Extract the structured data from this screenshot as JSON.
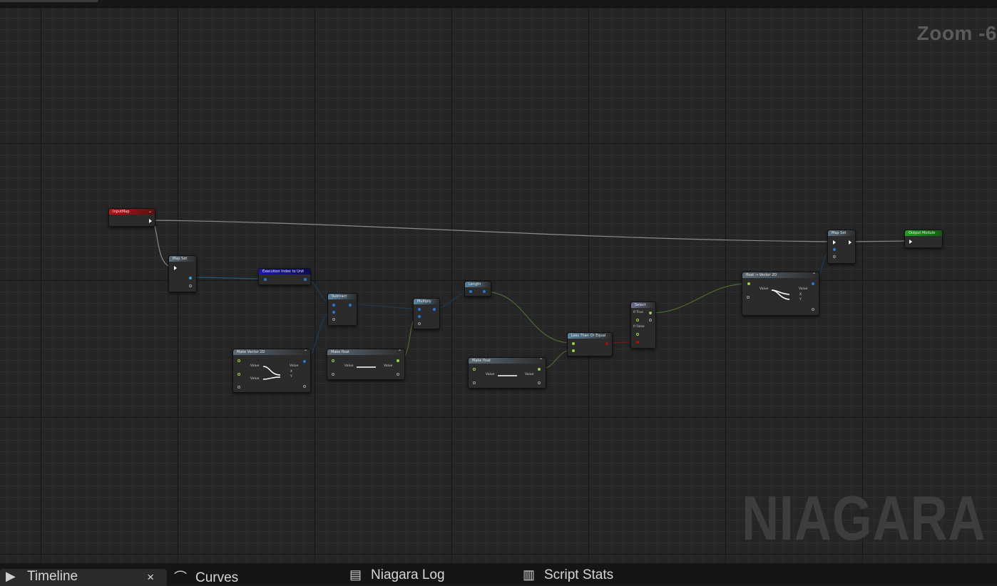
{
  "graph": {
    "zoom_label": "Zoom -6",
    "watermark": "NIAGARA",
    "nodes": {
      "input_map": {
        "title": "InputMap",
        "color": "#a11515"
      },
      "map_set_1": {
        "title": "Map Set",
        "color": "#4a5d6b"
      },
      "exec_index": {
        "title": "Execution Index to Unit",
        "color": "#15138a"
      },
      "subtract": {
        "title": "Subtract",
        "color": "#4e6b80"
      },
      "multiply": {
        "title": "Multiply",
        "color": "#4e6b80"
      },
      "length": {
        "title": "Length",
        "color": "#4e6b80"
      },
      "make_vector2d": {
        "title": "Make Vector 2D",
        "color": "#4e5c66",
        "pin_value_1": "Value",
        "pin_value_2": "Value",
        "out_value": "Value",
        "out_x": "X",
        "out_y": "Y"
      },
      "make_float_1": {
        "title": "Make float",
        "color": "#4e5c66",
        "pin_value": "Value",
        "out_value": "Value"
      },
      "make_float_2": {
        "title": "Make float",
        "color": "#4e5c66",
        "pin_value": "Value",
        "out_value": "Value"
      },
      "less_than": {
        "title": "Less Than Or Equal",
        "color": "#4e6b80"
      },
      "select": {
        "title": "Select",
        "color": "#5a6076",
        "if_true": "If True",
        "if_false": "If False"
      },
      "float_to_vec": {
        "title": "float → Vector 2D",
        "color": "#4e5c66",
        "pin_value": "Value",
        "out_value": "Value",
        "out_x": "X",
        "out_y": "Y"
      },
      "map_set_2": {
        "title": "Map Set",
        "color": "#4a5d6b"
      },
      "output_module": {
        "title": "Output Module",
        "color": "#1e8f1e"
      }
    },
    "wire_colors": {
      "exec": "#9a9a9a",
      "blue": "#1e4a6e",
      "float": "#4a6a35"
    }
  },
  "bottom_tabs": [
    {
      "label": "Timeline",
      "icon": "play-icon"
    },
    {
      "label": "Curves",
      "icon": "curves-icon"
    },
    {
      "label": "Niagara Log",
      "icon": "log-icon"
    },
    {
      "label": "Script Stats",
      "icon": "stats-icon"
    }
  ],
  "close_glyph": "×"
}
